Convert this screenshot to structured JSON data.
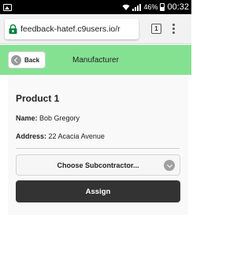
{
  "status_bar": {
    "battery": "46%",
    "time": "00:32",
    "icons": [
      "photo-icon",
      "wifi-icon",
      "signal-icon",
      "battery-icon"
    ]
  },
  "browser": {
    "url": "feedback-hatef.c9users.io/r",
    "tab_count": "1",
    "icons": [
      "lock-icon",
      "tabs-icon",
      "menu-icon"
    ]
  },
  "header": {
    "back_label": "Back",
    "title": "Manufacturer",
    "background": "#85e192"
  },
  "product": {
    "title": "Product 1",
    "name_label": "Name:",
    "name_value": "Bob Gregory",
    "address_label": "Address:",
    "address_value": "22 Acacia Avenue"
  },
  "form": {
    "select_placeholder": "Choose Subcontractor...",
    "assign_label": "Assign"
  },
  "colors": {
    "accent": "#85e192",
    "button": "#333333",
    "chrome_lock": "#0b8043"
  }
}
